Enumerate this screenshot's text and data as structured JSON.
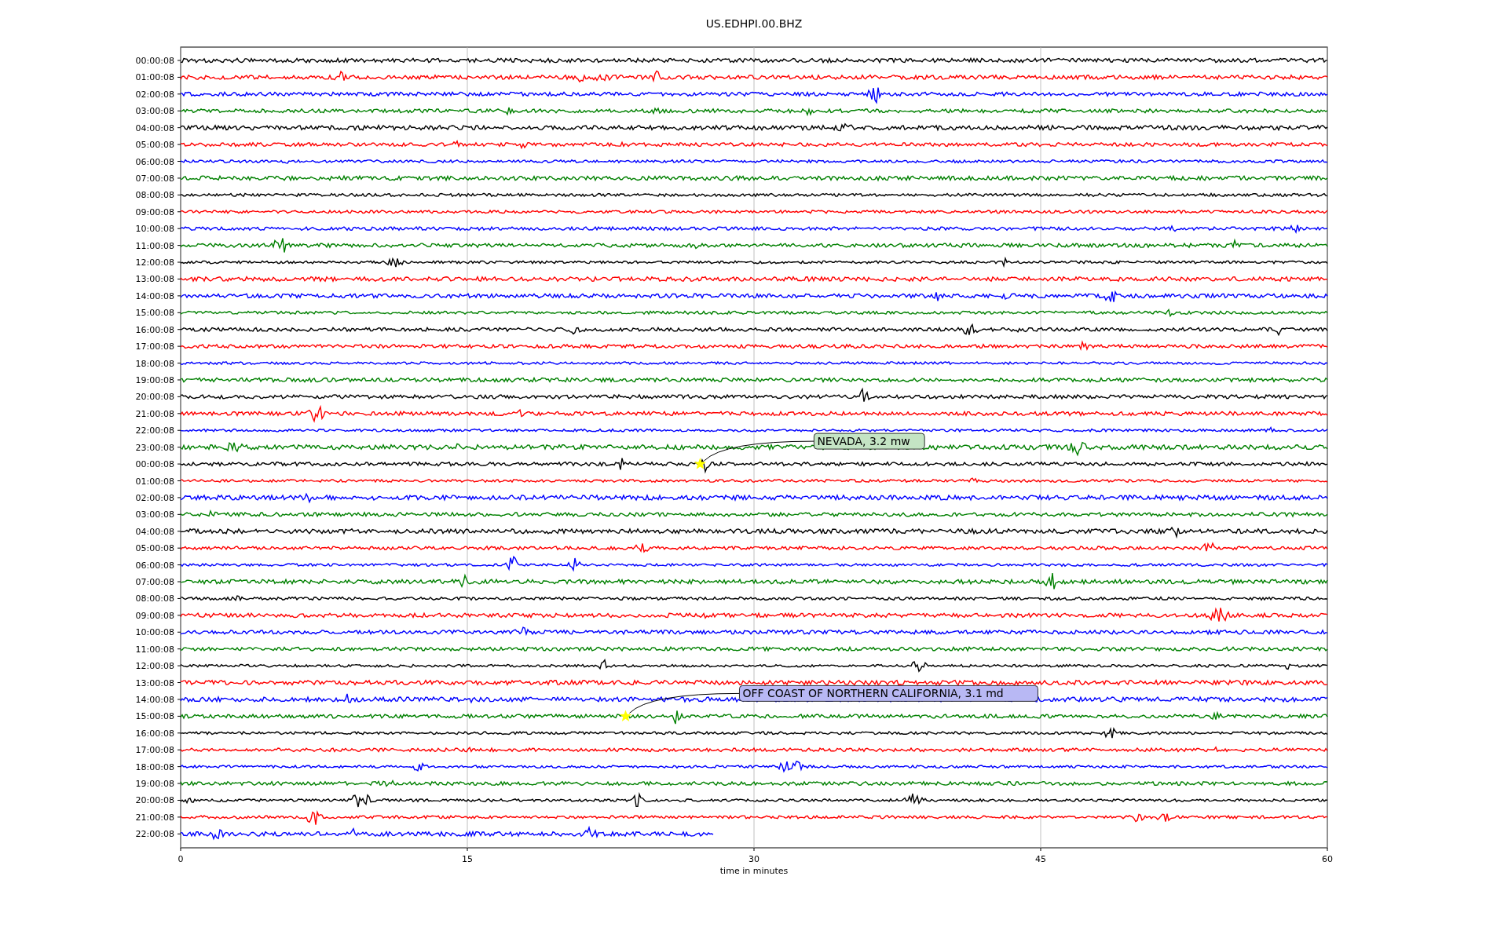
{
  "title": "US.EDHPI.00.BHZ",
  "xlabel": "time in minutes",
  "xticks": [
    "0",
    "15",
    "30",
    "45",
    "60"
  ],
  "traces": [
    {
      "label": "00:00:08",
      "color": "#000000"
    },
    {
      "label": "01:00:08",
      "color": "#ff0000"
    },
    {
      "label": "02:00:08",
      "color": "#0000ff"
    },
    {
      "label": "03:00:08",
      "color": "#008000"
    },
    {
      "label": "04:00:08",
      "color": "#000000"
    },
    {
      "label": "05:00:08",
      "color": "#ff0000"
    },
    {
      "label": "06:00:08",
      "color": "#0000ff"
    },
    {
      "label": "07:00:08",
      "color": "#008000"
    },
    {
      "label": "08:00:08",
      "color": "#000000"
    },
    {
      "label": "09:00:08",
      "color": "#ff0000"
    },
    {
      "label": "10:00:08",
      "color": "#0000ff"
    },
    {
      "label": "11:00:08",
      "color": "#008000"
    },
    {
      "label": "12:00:08",
      "color": "#000000"
    },
    {
      "label": "13:00:08",
      "color": "#ff0000"
    },
    {
      "label": "14:00:08",
      "color": "#0000ff"
    },
    {
      "label": "15:00:08",
      "color": "#008000"
    },
    {
      "label": "16:00:08",
      "color": "#000000"
    },
    {
      "label": "17:00:08",
      "color": "#ff0000"
    },
    {
      "label": "18:00:08",
      "color": "#0000ff"
    },
    {
      "label": "19:00:08",
      "color": "#008000"
    },
    {
      "label": "20:00:08",
      "color": "#000000"
    },
    {
      "label": "21:00:08",
      "color": "#ff0000"
    },
    {
      "label": "22:00:08",
      "color": "#0000ff"
    },
    {
      "label": "23:00:08",
      "color": "#008000"
    },
    {
      "label": "00:00:08",
      "color": "#000000",
      "event": {
        "label": "NEVADA, 3.2 mw",
        "color": "#c4e4c4"
      }
    },
    {
      "label": "01:00:08",
      "color": "#ff0000"
    },
    {
      "label": "02:00:08",
      "color": "#0000ff"
    },
    {
      "label": "03:00:08",
      "color": "#008000"
    },
    {
      "label": "04:00:08",
      "color": "#000000"
    },
    {
      "label": "05:00:08",
      "color": "#ff0000"
    },
    {
      "label": "06:00:08",
      "color": "#0000ff"
    },
    {
      "label": "07:00:08",
      "color": "#008000"
    },
    {
      "label": "08:00:08",
      "color": "#000000"
    },
    {
      "label": "09:00:08",
      "color": "#ff0000"
    },
    {
      "label": "10:00:08",
      "color": "#0000ff"
    },
    {
      "label": "11:00:08",
      "color": "#008000"
    },
    {
      "label": "12:00:08",
      "color": "#000000"
    },
    {
      "label": "13:00:08",
      "color": "#ff0000"
    },
    {
      "label": "14:00:08",
      "color": "#0000ff"
    },
    {
      "label": "15:00:08",
      "color": "#008000",
      "event": {
        "label": "OFF COAST OF NORTHERN CALIFORNIA, 3.1 md",
        "color": "#b8b8f4"
      }
    },
    {
      "label": "16:00:08",
      "color": "#000000"
    },
    {
      "label": "17:00:08",
      "color": "#ff0000"
    },
    {
      "label": "18:00:08",
      "color": "#0000ff"
    },
    {
      "label": "19:00:08",
      "color": "#008000"
    },
    {
      "label": "20:00:08",
      "color": "#000000"
    },
    {
      "label": "21:00:08",
      "color": "#ff0000"
    },
    {
      "label": "22:00:08",
      "color": "#0000ff"
    }
  ]
}
